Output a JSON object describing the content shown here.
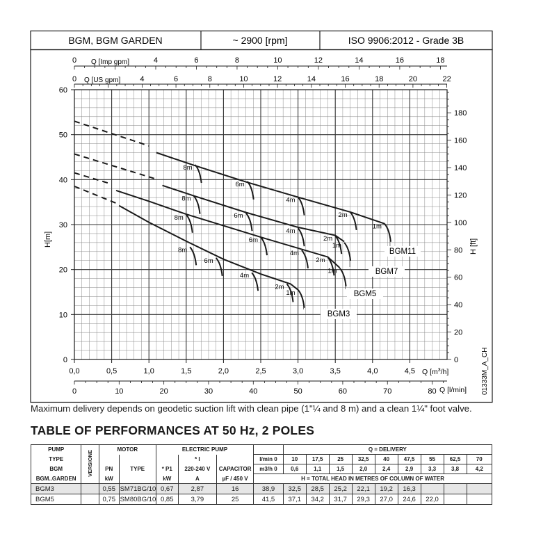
{
  "header": {
    "model": "BGM, BGM GARDEN",
    "speed": "~ 2900 [rpm]",
    "standard": "ISO 9906:2012 - Grade 3B"
  },
  "chart_data": {
    "type": "line",
    "x_axis": {
      "label": "Q [m³/h]",
      "range": [
        0,
        5
      ],
      "ticks": [
        "0,0",
        "0,5",
        "1,0",
        "1,5",
        "2,0",
        "2,5",
        "3,0",
        "3,5",
        "4,0",
        "4,5"
      ]
    },
    "x_axis_lmin": {
      "label": "Q [l/min]",
      "ticks": [
        "0",
        "10",
        "20",
        "30",
        "40",
        "50",
        "60",
        "70",
        "80"
      ]
    },
    "x_axis_usgpm": {
      "label": "Q [US gpm]",
      "ticks": [
        "0",
        "2",
        "4",
        "6",
        "8",
        "10",
        "12",
        "14",
        "16",
        "18",
        "20",
        "22"
      ]
    },
    "x_axis_impgpm": {
      "label": "Q [Imp gpm]",
      "ticks": [
        "0",
        "2",
        "4",
        "6",
        "8",
        "10",
        "12",
        "14",
        "16",
        "18"
      ]
    },
    "y_axis": {
      "label": "H[m]",
      "range": [
        0,
        60
      ],
      "ticks": [
        "0",
        "10",
        "20",
        "30",
        "40",
        "50",
        "60"
      ]
    },
    "y_axis_ft": {
      "label": "H [ft]",
      "ticks": [
        "0",
        "20",
        "40",
        "60",
        "80",
        "100",
        "120",
        "140",
        "160",
        "180"
      ]
    },
    "grid": true,
    "side_label": "01333M_A_CH",
    "series": [
      {
        "name": "BGM11",
        "dashed": [
          [
            0,
            53
          ],
          [
            1.0,
            47.5
          ]
        ],
        "solid": [
          [
            1.1,
            46
          ],
          [
            1.6,
            43.2
          ],
          [
            2.3,
            39.5
          ],
          [
            3.0,
            36.1
          ],
          [
            3.7,
            32.8
          ],
          [
            4.16,
            30.2
          ]
        ],
        "suction": [
          {
            "label": "8m",
            "pt": [
              1.62,
              43.3
            ]
          },
          {
            "label": "6m",
            "pt": [
              2.32,
              39.6
            ]
          },
          {
            "label": "4m",
            "pt": [
              3.0,
              36.1
            ]
          },
          {
            "label": "2m",
            "pt": [
              3.7,
              32.8
            ]
          },
          {
            "label": "1m",
            "pt": [
              4.16,
              30.2
            ]
          }
        ]
      },
      {
        "name": "BGM7",
        "dashed": [
          [
            0,
            45.7
          ],
          [
            1.08,
            40.2
          ]
        ],
        "solid": [
          [
            1.18,
            38.7
          ],
          [
            1.6,
            36.4
          ],
          [
            2.3,
            32.7
          ],
          [
            3.0,
            29.4
          ],
          [
            3.5,
            27.6
          ],
          [
            3.62,
            26.2
          ]
        ],
        "suction": [
          {
            "label": "8m",
            "pt": [
              1.6,
              36.4
            ]
          },
          {
            "label": "6m",
            "pt": [
              2.3,
              32.6
            ]
          },
          {
            "label": "4m",
            "pt": [
              3.0,
              29.2
            ]
          },
          {
            "label": "2m",
            "pt": [
              3.5,
              27.5
            ]
          },
          {
            "label": "1m",
            "pt": [
              3.62,
              26.0
            ]
          }
        ]
      },
      {
        "name": "BGM5",
        "dashed": [
          [
            0,
            41.5
          ],
          [
            0.5,
            39
          ]
        ],
        "solid": [
          [
            0.56,
            37.6
          ],
          [
            1.0,
            35.2
          ],
          [
            1.5,
            32.3
          ],
          [
            2.5,
            27.2
          ],
          [
            3.4,
            22.8
          ],
          [
            3.56,
            20.4
          ]
        ],
        "suction": [
          {
            "label": "8m",
            "pt": [
              1.5,
              32.2
            ]
          },
          {
            "label": "6m",
            "pt": [
              2.5,
              27.2
            ]
          },
          {
            "label": "4m",
            "pt": [
              3.05,
              24.3
            ]
          },
          {
            "label": "2m",
            "pt": [
              3.4,
              22.7
            ]
          },
          {
            "label": "1m",
            "pt": [
              3.56,
              20.3
            ]
          }
        ]
      },
      {
        "name": "BGM3",
        "dashed": [
          [
            0,
            38.5
          ],
          [
            0.6,
            34.5
          ]
        ],
        "solid": [
          [
            0.6,
            34.2
          ],
          [
            1.0,
            30.5
          ],
          [
            1.5,
            26.3
          ],
          [
            2.0,
            22.3
          ],
          [
            2.5,
            19.0
          ],
          [
            2.9,
            16.8
          ],
          [
            3.0,
            15.5
          ]
        ],
        "suction": [
          {
            "label": "8m",
            "pt": [
              1.55,
              25.0
            ]
          },
          {
            "label": "6m",
            "pt": [
              1.9,
              22.6
            ]
          },
          {
            "label": "4m",
            "pt": [
              2.38,
              19.3
            ]
          },
          {
            "label": "2m",
            "pt": [
              2.85,
              16.8
            ]
          },
          {
            "label": "1m",
            "pt": [
              3.0,
              15.5
            ]
          }
        ]
      }
    ]
  },
  "footnote": "Maximum delivery depends on geodetic suction lift with clean pipe (1\"¼ and 8 m) and a clean 1¼\" foot valve.",
  "table": {
    "title": "TABLE OF PERFORMANCES AT 50 Hz, 2 POLES",
    "h_pump": "PUMP",
    "h_type": "TYPE",
    "h_bgm": "BGM",
    "h_bgmgarden": "BGM..GARDEN",
    "h_versione": "VERSIONE",
    "h_motor": "MOTOR",
    "h_pn": "PN",
    "h_pn_sub": "N",
    "h_kw": "kW",
    "h_type2": "TYPE",
    "h_electric": "ELECTRIC PUMP",
    "h_p1": "* P1",
    "h_kw2": "kW",
    "h_i": "* I",
    "h_voltage": "220-240 V",
    "h_amp": "A",
    "h_capacitor": "CAPACITOR",
    "h_cap_unit": "µF / 450 V",
    "h_q": "Q = DELIVERY",
    "h_lmin": "l/min 0",
    "h_m3h": "m3/h 0",
    "lmin": [
      "10",
      "17,5",
      "25",
      "32,5",
      "40",
      "47,5",
      "55",
      "62,5",
      "70"
    ],
    "m3h": [
      "0,6",
      "1,1",
      "1,5",
      "2,0",
      "2,4",
      "2,9",
      "3,3",
      "3,8",
      "4,2"
    ],
    "h_head": "H = TOTAL HEAD IN METRES OF COLUMN OF WATER",
    "rows": [
      {
        "pump": "BGM3",
        "pn": "0,55",
        "type": "SM71BG/1055",
        "p1": "0,67",
        "i": "2,87",
        "cap": "16",
        "h": [
          "38,9",
          "32,5",
          "28,5",
          "25,2",
          "22,1",
          "19,2",
          "16,3",
          "",
          ""
        ],
        "h0_hidden": ""
      },
      {
        "pump": "BGM5",
        "pn": "0,75",
        "type": "SM80BG/1075",
        "p1": "0,85",
        "i": "3,79",
        "cap": "25",
        "h": [
          "41,5",
          "37,1",
          "34,2",
          "31,7",
          "29,3",
          "27,0",
          "24,6",
          "22,0",
          ""
        ]
      }
    ]
  }
}
